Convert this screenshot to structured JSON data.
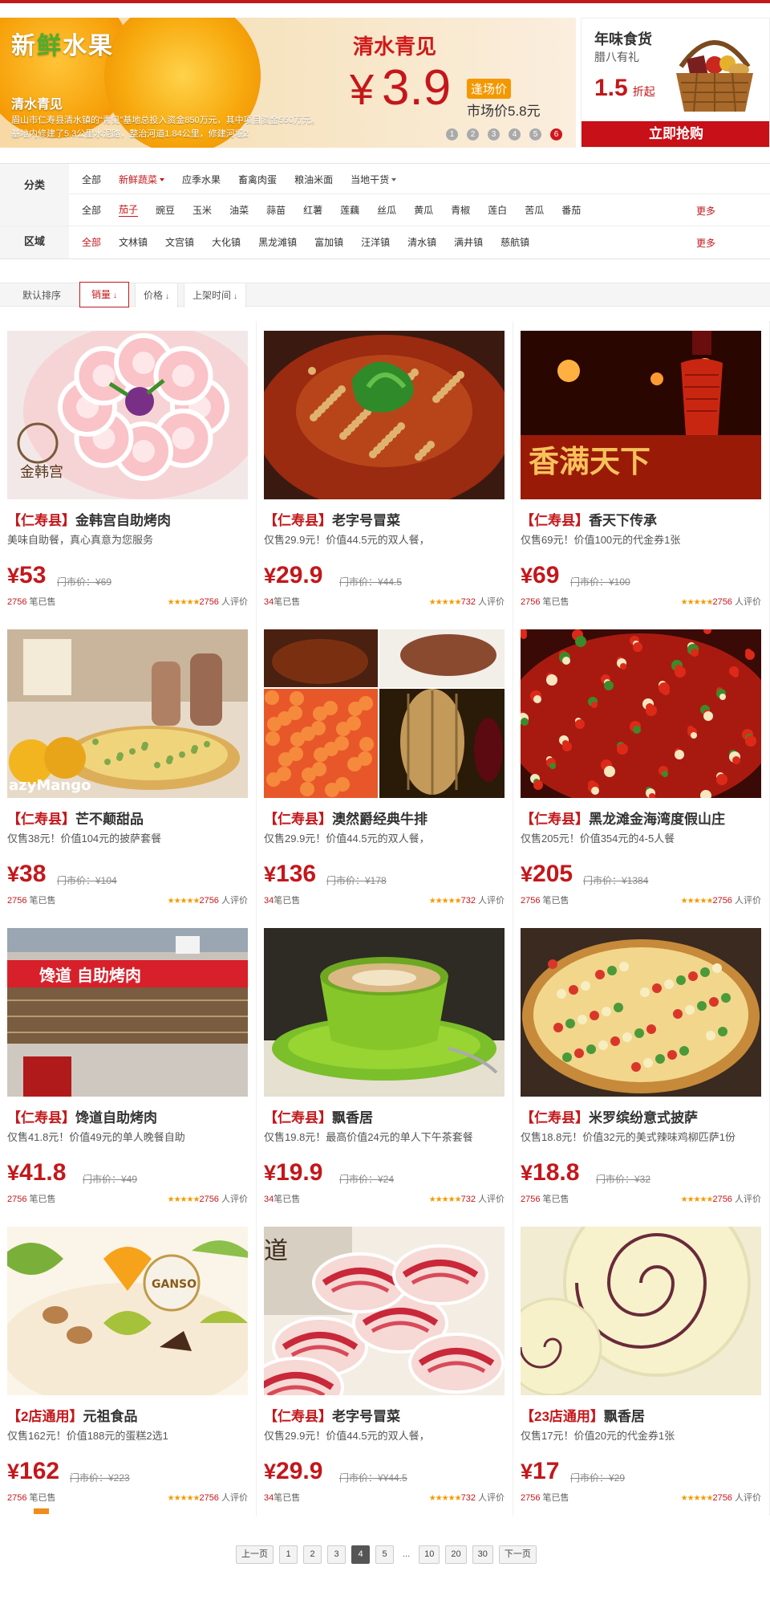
{
  "banner": {
    "logo_text_1": "新",
    "logo_text_2": "鲜",
    "logo_text_3": "水果",
    "sub_title": "清水青见",
    "desc": "眉山市仁寿县清水镇的“青见”基地总投入资金850万元，其中项目资金550万元。基地内修建了5.3公里水泥路，整治河道1.84公里，修建河堰2",
    "promo_title": "清水青见",
    "price_symbol": "¥",
    "price": "3.9",
    "tag": "逢场价",
    "market_price": "市场价5.8元",
    "dots": [
      "1",
      "2",
      "3",
      "4",
      "5",
      "6"
    ],
    "active_dot": 5
  },
  "side_ad": {
    "title": "年味食货",
    "subtitle": "腊八有礼",
    "discount": "1.5",
    "discount_unit": "折起",
    "button": "立即抢购"
  },
  "filter": {
    "category_label": "分类",
    "category_row1": [
      {
        "text": "全部",
        "state": "normal"
      },
      {
        "text": "新鲜蔬菜",
        "state": "red-caret"
      },
      {
        "text": "应季水果",
        "state": "normal"
      },
      {
        "text": "畜禽肉蛋",
        "state": "normal"
      },
      {
        "text": "粮油米面",
        "state": "normal"
      },
      {
        "text": "当地干货",
        "state": "caret"
      }
    ],
    "category_row2": [
      "全部",
      "茄子",
      "豌豆",
      "玉米",
      "油菜",
      "蒜苗",
      "红薯",
      "莲藕",
      "丝瓜",
      "黄瓜",
      "青椒",
      "莲白",
      "苦瓜",
      "番茄"
    ],
    "category_row2_selected": 1,
    "more": "更多",
    "area_label": "区域",
    "area_items": [
      "全部",
      "文林镇",
      "文宫镇",
      "大化镇",
      "黑龙滩镇",
      "富加镇",
      "汪洋镇",
      "清水镇",
      "满井镇",
      "慈航镇"
    ],
    "area_selected": 0
  },
  "sort": {
    "default": "默认排序",
    "sales": "销量",
    "price": "价格",
    "new": "上架时间"
  },
  "products": [
    {
      "region": "【仁寿县】",
      "name": "金韩宫自助烤肉",
      "desc": "美味自助餐，真心真意为您服务",
      "price": "53",
      "orig": "门市价：¥69",
      "sold": "2756",
      "sold_suffix": " 笔已售",
      "reviews": "2756",
      "reviews_suffix": " 人评价"
    },
    {
      "region": "【仁寿县】",
      "name": "老字号冒菜",
      "desc": "仅售29.9元！价值44.5元的双人餐，",
      "price": "29.9",
      "orig": "门市价：¥44.5",
      "sold": "34",
      "sold_suffix": "笔已售",
      "reviews": "732",
      "reviews_suffix": " 人评价"
    },
    {
      "region": "【仁寿县】",
      "name": "香天下传承",
      "desc": "仅售69元！价值100元的代金券1张",
      "price": "69",
      "orig": "门市价：¥100",
      "sold": "2756",
      "sold_suffix": " 笔已售",
      "reviews": "2756",
      "reviews_suffix": " 人评价"
    },
    {
      "region": "【仁寿县】",
      "name": "芒不颠甜品",
      "desc": "仅售38元！价值104元的披萨套餐",
      "price": "38",
      "orig": "门市价：¥104",
      "sold": "2756",
      "sold_suffix": " 笔已售",
      "reviews": "2756",
      "reviews_suffix": " 人评价"
    },
    {
      "region": "【仁寿县】",
      "name": "澳然爵经典牛排",
      "desc": "仅售29.9元！价值44.5元的双人餐，",
      "price": "136",
      "orig": "门市价：¥178",
      "sold": "34",
      "sold_suffix": "笔已售",
      "reviews": "732",
      "reviews_suffix": " 人评价"
    },
    {
      "region": "【仁寿县】",
      "name": "黑龙滩金海湾度假山庄",
      "desc": "仅售205元！价值354元的4-5人餐",
      "price": "205",
      "orig": "门市价：¥1384",
      "sold": "2756",
      "sold_suffix": " 笔已售",
      "reviews": "2756",
      "reviews_suffix": " 人评价"
    },
    {
      "region": "【仁寿县】",
      "name": "馋道自助烤肉",
      "desc": "仅售41.8元！价值49元的单人晚餐自助",
      "price": "41.8",
      "orig": "门市价：¥49",
      "sold": "2756",
      "sold_suffix": " 笔已售",
      "reviews": "2756",
      "reviews_suffix": " 人评价"
    },
    {
      "region": "【仁寿县】",
      "name": "飘香居",
      "desc": "仅售19.8元！最高价值24元的单人下午茶套餐",
      "price": "19.9",
      "orig": "门市价：¥24",
      "sold": "34",
      "sold_suffix": "笔已售",
      "reviews": "732",
      "reviews_suffix": " 人评价"
    },
    {
      "region": "【仁寿县】",
      "name": "米罗缤纷意式披萨",
      "desc": "仅售18.8元！价值32元的美式辣味鸡柳匹萨1份",
      "price": "18.8",
      "orig": "门市价：¥32",
      "sold": "2756",
      "sold_suffix": " 笔已售",
      "reviews": "2756",
      "reviews_suffix": " 人评价"
    },
    {
      "region": "【2店通用】",
      "name": "元祖食品",
      "desc": "仅售162元！价值188元的蛋糕2选1",
      "price": "162",
      "orig": "门市价：¥223",
      "sold": "2756",
      "sold_suffix": " 笔已售",
      "reviews": "2756",
      "reviews_suffix": " 人评价"
    },
    {
      "region": "【仁寿县】",
      "name": "老字号冒菜",
      "desc": "仅售29.9元！价值44.5元的双人餐，",
      "price": "29.9",
      "orig": "门市价：¥¥44.5",
      "sold": "34",
      "sold_suffix": "笔已售",
      "reviews": "732",
      "reviews_suffix": " 人评价"
    },
    {
      "region": "【23店通用】",
      "name": "飘香居",
      "desc": "仅售17元！价值20元的代金券1张",
      "price": "17",
      "orig": "门市价：¥29",
      "sold": "2756",
      "sold_suffix": " 笔已售",
      "reviews": "2756",
      "reviews_suffix": " 人评价"
    }
  ],
  "product_image_text": {
    "jinhangong": "金韩宫",
    "xiangtianxia": "香满天下",
    "mango": "azyMango",
    "chandao": "馋道  自助烤肉",
    "ganso": "GANSO"
  },
  "pager": {
    "prev": "上一页",
    "pages": [
      "1",
      "2",
      "3",
      "4",
      "5"
    ],
    "active": 3,
    "ellipsis": "...",
    "tail_pages": [
      "10",
      "20",
      "30"
    ],
    "next": "下一页"
  },
  "colors": {
    "accent": "#c4171b",
    "star": "#f59a00",
    "tag": "#f39800"
  }
}
